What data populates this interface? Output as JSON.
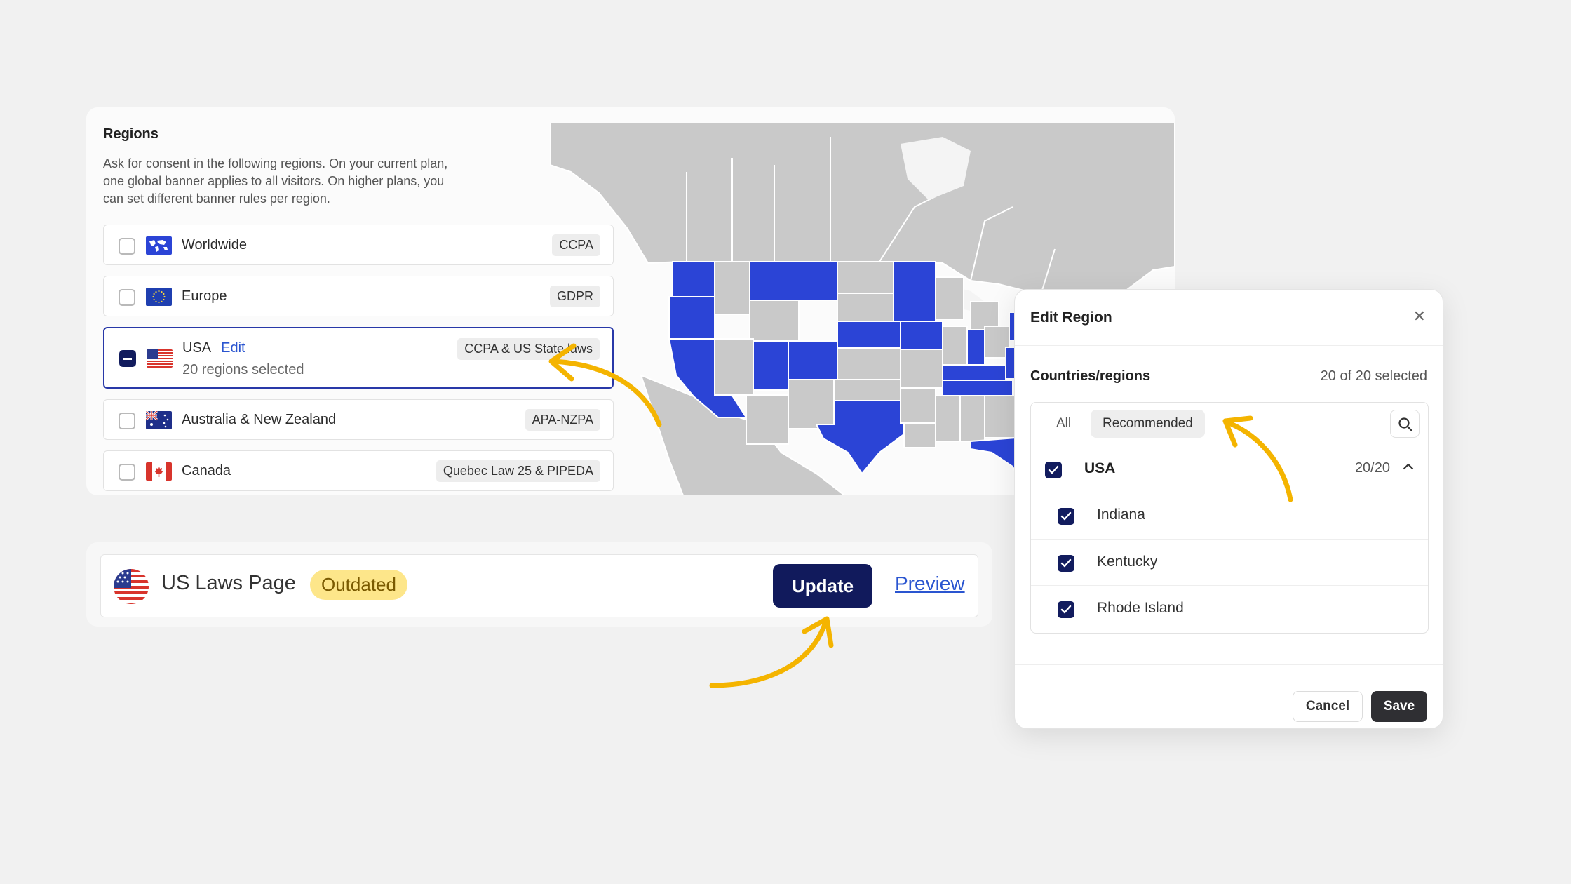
{
  "regions": {
    "title": "Regions",
    "description": "Ask for consent in the following regions. On your current plan, one global banner applies to all visitors. On higher plans, you can set different banner rules per region.",
    "items": [
      {
        "name": "Worldwide",
        "tag": "CCPA",
        "checked": false
      },
      {
        "name": "Europe",
        "tag": "GDPR",
        "checked": false
      },
      {
        "name": "USA",
        "edit": "Edit",
        "sub": "20 regions selected",
        "tag": "CCPA & US State laws",
        "checked": "partial"
      },
      {
        "name": "Australia & New Zealand",
        "tag": "APA-NZPA",
        "checked": false
      },
      {
        "name": "Canada",
        "tag": "Quebec Law 25 & PIPEDA",
        "checked": false
      }
    ]
  },
  "laws_page": {
    "title": "US Laws Page",
    "status": "Outdated",
    "update_label": "Update",
    "preview_label": "Preview"
  },
  "modal": {
    "title": "Edit Region",
    "close_icon": "close-icon",
    "section_label": "Countries/regions",
    "selected_count": "20 of 20 selected",
    "filters": {
      "all": "All",
      "recommended": "Recommended"
    },
    "group": {
      "name": "USA",
      "count": "20/20"
    },
    "items": [
      "Indiana",
      "Kentucky",
      "Rhode Island"
    ],
    "cancel_label": "Cancel",
    "save_label": "Save"
  },
  "colors": {
    "selected_state": "#2b44d6",
    "unselected_state": "#c9c9c9",
    "primary_button": "#111a5c",
    "outdated_badge": "#fde68a",
    "arrow": "#f4b400"
  }
}
